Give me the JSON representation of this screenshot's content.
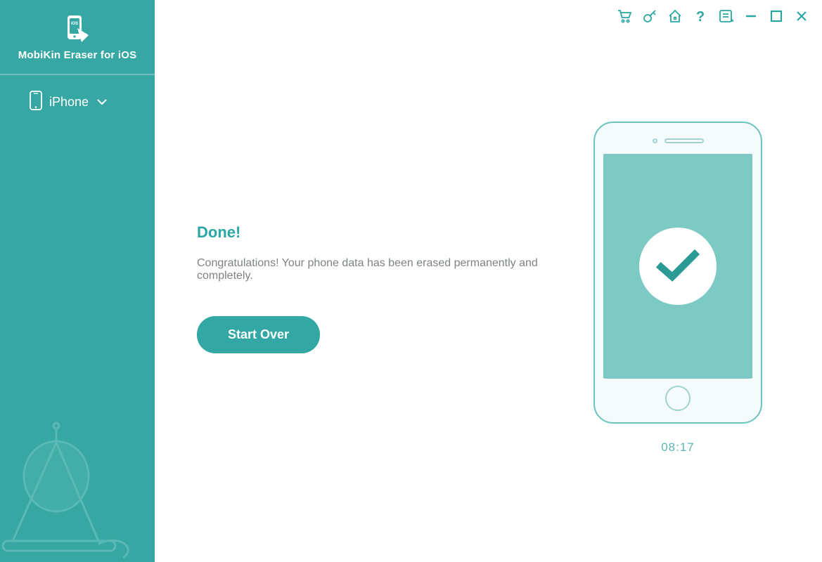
{
  "colors": {
    "accent": "#37a7a3"
  },
  "sidebar": {
    "app_title": "MobiKin Eraser for iOS",
    "device_label": "iPhone"
  },
  "titlebar": {
    "icons": {
      "cart": "cart-icon",
      "key": "key-icon",
      "home": "home-icon",
      "help": "help-icon",
      "feedback": "feedback-icon",
      "minimize": "minimize-icon",
      "maximize": "maximize-icon",
      "close": "close-icon"
    }
  },
  "result": {
    "title": "Done!",
    "message": "Congratulations! Your phone data has been erased permanently and completely.",
    "start_over_label": "Start Over"
  },
  "timer": "08:17"
}
